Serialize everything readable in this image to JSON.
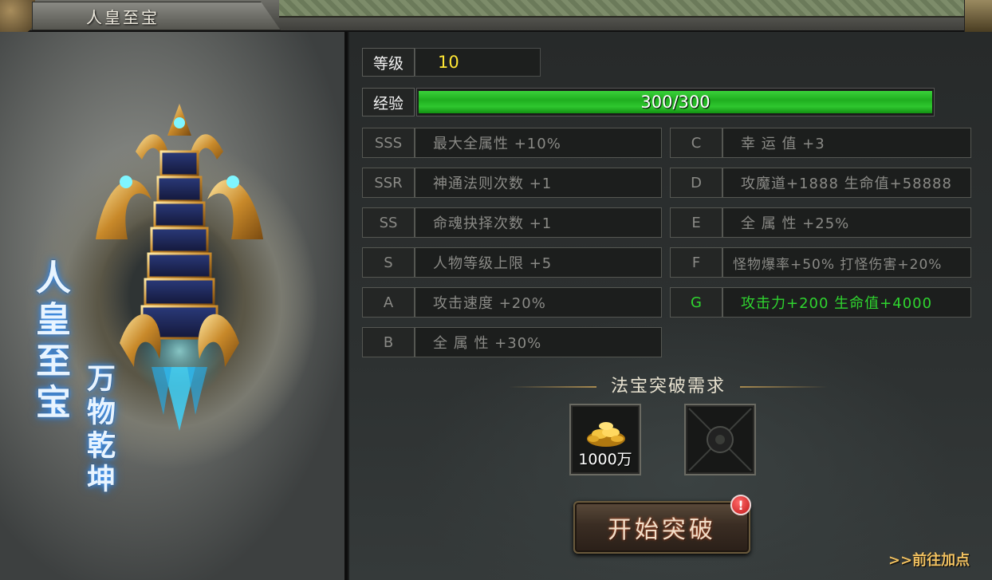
{
  "window": {
    "title": "人皇至宝"
  },
  "art": {
    "name_main": "人皇至宝",
    "name_sub": "万物乾坤"
  },
  "level": {
    "label": "等级",
    "value": "10"
  },
  "experience": {
    "label": "经验",
    "text": "300/300",
    "fraction": 1.0
  },
  "attributes": {
    "left": [
      {
        "grade": "SSS",
        "text": "最大全属性 +10%"
      },
      {
        "grade": "SSR",
        "text": "神通法则次数 +1"
      },
      {
        "grade": "SS",
        "text": "命魂抉择次数 +1"
      },
      {
        "grade": "S",
        "text": "人物等级上限 +5"
      },
      {
        "grade": "A",
        "text": "攻击速度 +20%"
      },
      {
        "grade": "B",
        "text": "全 属 性 +30%"
      }
    ],
    "right": [
      {
        "grade": "C",
        "text": "幸 运 值 +3"
      },
      {
        "grade": "D",
        "text": "攻魔道+1888 生命值+58888"
      },
      {
        "grade": "E",
        "text": "全 属 性 +25%"
      },
      {
        "grade": "F",
        "text": "怪物爆率+50% 打怪伤害+20%"
      },
      {
        "grade": "G",
        "text": "攻击力+200 生命值+4000",
        "active": true
      }
    ]
  },
  "breakthrough": {
    "title": "法宝突破需求",
    "gold_amount": "1000万",
    "button_label": "开始突破",
    "alert_badge": "!"
  },
  "goto_link": ">>前往加点",
  "colors": {
    "active_grade": "#2fd52f",
    "level_value": "#ffe634",
    "exp_fill": "#2fc72f"
  }
}
